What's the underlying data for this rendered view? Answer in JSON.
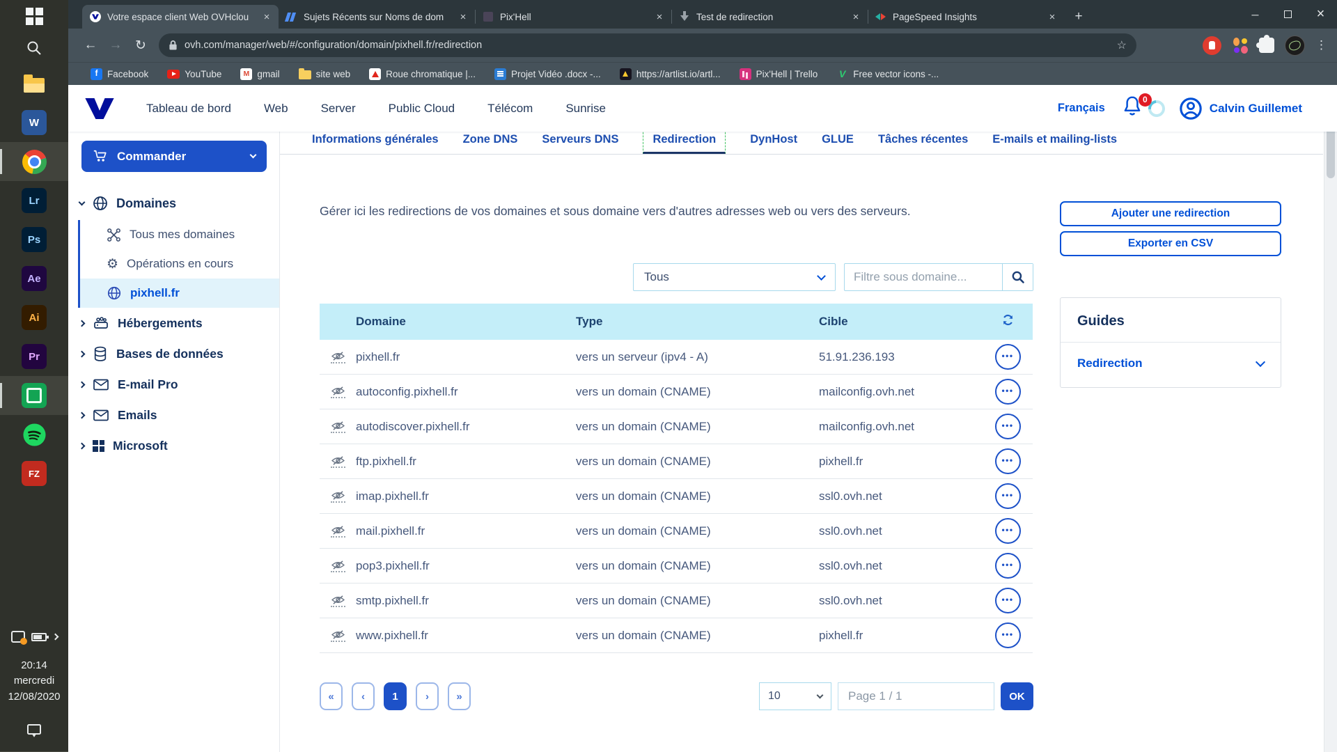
{
  "colors": {
    "accent": "#0050d7",
    "primary": "#1d51c8",
    "table_header_bg": "#c4eef9",
    "badge": "#e01b24",
    "focus_dash_green": "#43c463"
  },
  "icons": {
    "back": "←",
    "forward": "→",
    "reload": "↻",
    "star": "☆",
    "menu": "⋮",
    "plus": "+",
    "close": "×",
    "minimize": "─",
    "gear": "⚙",
    "ellipsis": "•••",
    "first": "«",
    "prev": "‹",
    "next": "›",
    "last": "»"
  },
  "taskbar": {
    "clock": {
      "time": "20:14",
      "day": "mercredi",
      "date": "12/08/2020"
    }
  },
  "browser": {
    "tabs": [
      {
        "title": "Votre espace client Web OVHclou"
      },
      {
        "title": "Sujets Récents sur Noms de dom"
      },
      {
        "title": "Pix'Hell"
      },
      {
        "title": "Test de redirection"
      },
      {
        "title": "PageSpeed Insights"
      }
    ],
    "url": "ovh.com/manager/web/#/configuration/domain/pixhell.fr/redirection",
    "bookmarks": [
      "Facebook",
      "YouTube",
      "gmail",
      "site web",
      "Roue chromatique |...",
      "Projet Vidéo .docx -...",
      "https://artlist.io/artl...",
      "Pix'Hell | Trello",
      "Free vector icons -..."
    ]
  },
  "app": {
    "header": {
      "nav": [
        "Tableau de bord",
        "Web",
        "Server",
        "Public Cloud",
        "Télécom",
        "Sunrise"
      ],
      "active_nav": "Web",
      "language": "Français",
      "notification_count": "0",
      "user": "Calvin Guillemet"
    },
    "sidebar": {
      "order_button": "Commander",
      "domaines": {
        "label": "Domaines",
        "items": [
          {
            "label": "Tous mes domaines"
          },
          {
            "label": "Opérations en cours"
          },
          {
            "label": "pixhell.fr",
            "active": true
          }
        ]
      },
      "sections": [
        {
          "label": "Hébergements"
        },
        {
          "label": "Bases de données"
        },
        {
          "label": "E-mail Pro"
        },
        {
          "label": "Emails"
        },
        {
          "label": "Microsoft"
        }
      ]
    },
    "tabs": [
      "Informations générales",
      "Zone DNS",
      "Serveurs DNS",
      "Redirection",
      "DynHost",
      "GLUE",
      "Tâches récentes",
      "E-mails et mailing-lists"
    ],
    "active_tab": "Redirection",
    "content": {
      "description": "Gérer ici les redirections de vos domaines et sous domaine vers d'autres adresses web ou vers des serveurs.",
      "add_button": "Ajouter une redirection",
      "export_button": "Exporter en CSV",
      "filter": {
        "selected": "Tous",
        "placeholder": "Filtre sous domaine..."
      },
      "table": {
        "headers": [
          "Domaine",
          "Type",
          "Cible"
        ],
        "rows": [
          {
            "domain": "pixhell.fr",
            "type": "vers un serveur (ipv4 - A)",
            "target": "51.91.236.193"
          },
          {
            "domain": "autoconfig.pixhell.fr",
            "type": "vers un domain (CNAME)",
            "target": "mailconfig.ovh.net"
          },
          {
            "domain": "autodiscover.pixhell.fr",
            "type": "vers un domain (CNAME)",
            "target": "mailconfig.ovh.net"
          },
          {
            "domain": "ftp.pixhell.fr",
            "type": "vers un domain (CNAME)",
            "target": "pixhell.fr"
          },
          {
            "domain": "imap.pixhell.fr",
            "type": "vers un domain (CNAME)",
            "target": "ssl0.ovh.net"
          },
          {
            "domain": "mail.pixhell.fr",
            "type": "vers un domain (CNAME)",
            "target": "ssl0.ovh.net"
          },
          {
            "domain": "pop3.pixhell.fr",
            "type": "vers un domain (CNAME)",
            "target": "ssl0.ovh.net"
          },
          {
            "domain": "smtp.pixhell.fr",
            "type": "vers un domain (CNAME)",
            "target": "ssl0.ovh.net"
          },
          {
            "domain": "www.pixhell.fr",
            "type": "vers un domain (CNAME)",
            "target": "pixhell.fr"
          }
        ]
      },
      "pagination": {
        "current": "1",
        "per_page": "10",
        "page_label": "Page 1 / 1",
        "ok_label": "OK"
      },
      "guides": {
        "title": "Guides",
        "link": "Redirection"
      }
    }
  }
}
